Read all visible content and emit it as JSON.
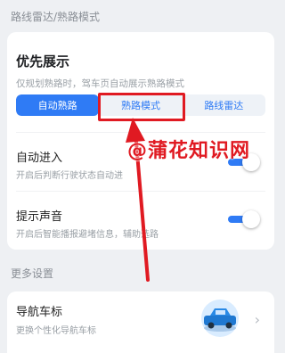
{
  "sections": {
    "radar_title": "路线雷达/熟路模式",
    "more_title": "更多设置"
  },
  "preference": {
    "title": "优先展示",
    "description": "仅规划熟路时，驾车页自动展示熟路模式",
    "options": [
      "自动熟路",
      "熟路模式",
      "路线雷达"
    ],
    "selected": "自动熟路"
  },
  "auto_enter": {
    "title": "自动进入",
    "description": "开启后判断行驶状态自动进",
    "enabled": true
  },
  "voice": {
    "title": "提示声音",
    "description": "开启后智能播报避堵信息，辅助选路",
    "enabled": true
  },
  "nav_car": {
    "title": "导航车标",
    "description": "更换个性化导航车标",
    "icon": "car-icon"
  },
  "watermark": "@蒲花知识网",
  "colors": {
    "accent": "#2f7bf5",
    "highlight": "#e01a22"
  }
}
